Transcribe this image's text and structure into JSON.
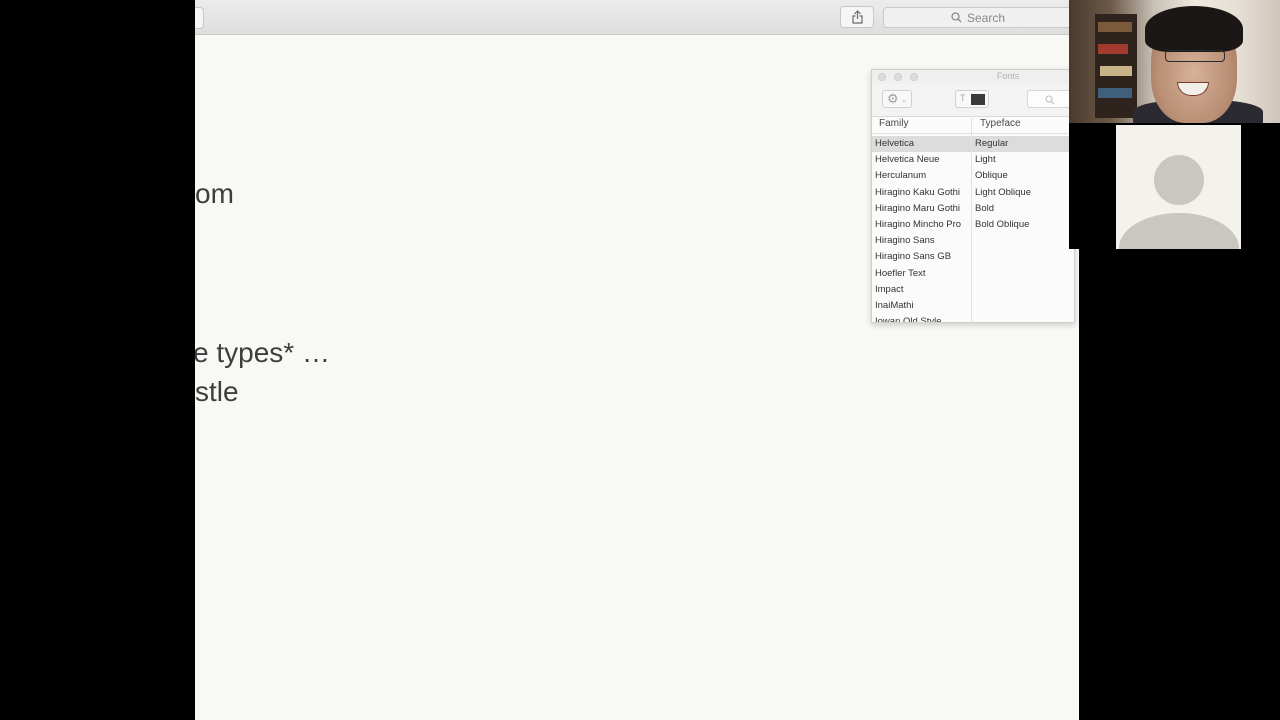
{
  "app": {
    "search_placeholder": "Search",
    "slide_lines": [
      "om",
      "e types* …",
      "stle"
    ]
  },
  "fonts_panel": {
    "title": "Fonts",
    "family_header": "Family",
    "typeface_header": "Typeface",
    "families": [
      "Helvetica",
      "Helvetica Neue",
      "Herculanum",
      "Hiragino Kaku Gothi",
      "Hiragino Maru Gothi",
      "Hiragino Mincho Pro",
      "Hiragino Sans",
      "Hiragino Sans GB",
      "Hoefler Text",
      "Impact",
      "InaiMathi",
      "Iowan Old Style"
    ],
    "typefaces": [
      "Regular",
      "Light",
      "Oblique",
      "Light Oblique",
      "Bold",
      "Bold Oblique"
    ],
    "selected_family": "Helvetica",
    "selected_typeface": "Regular",
    "text_color": "#3a3a3a"
  },
  "icons": {
    "share": "share-icon",
    "search": "search-icon",
    "gear": "gear-icon"
  }
}
